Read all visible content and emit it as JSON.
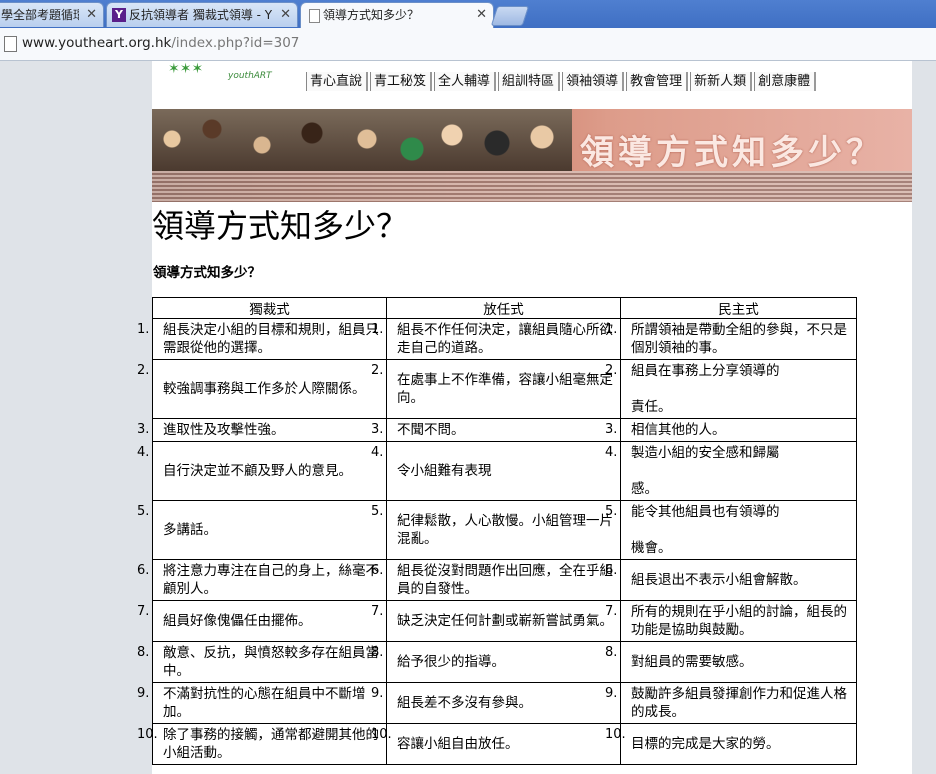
{
  "browser": {
    "tabs": [
      {
        "label": "學全部考題循環",
        "icon": "page-icon"
      },
      {
        "label": "反抗領導者 獨裁式領導 - Y",
        "icon": "yahoo-icon"
      },
      {
        "label": "領導方式知多少？",
        "icon": "page-icon"
      }
    ],
    "url_host": "www.youtheart.org.hk",
    "url_rest": "/index.php?id=307"
  },
  "site": {
    "logo_text": "youthART",
    "nav": [
      "青心直說",
      "青工秘笈",
      "全人輔導",
      "組訓特區",
      "領袖領導",
      "教會管理",
      "新新人類",
      "創意康體"
    ],
    "banner_title": "領導方式知多少？"
  },
  "article": {
    "title": "領導方式知多少？",
    "subtitle": "領導方式知多少？",
    "headers": [
      "獨裁式",
      "放任式",
      "民主式"
    ],
    "rows": [
      {
        "n": [
          "1.",
          "1.",
          "1."
        ],
        "cells": [
          "組長決定小組的目標和規則，組員只需跟從他的選擇。",
          "組長不作任何決定，讓組員隨心所欲走自己的道路。",
          "所謂領袖是帶動全組的參與，不只是個別領袖的事。"
        ]
      },
      {
        "n": [
          "2.",
          "2.",
          "2."
        ],
        "cells": [
          "較強調事務與工作多於人際關係。",
          "在處事上不作準備，容讓小組毫無定向。",
          "組員在事務上分享領導的\n\n責任。"
        ]
      },
      {
        "n": [
          "3.",
          "3.",
          "3."
        ],
        "cells": [
          "進取性及攻擊性強。",
          "不聞不問。",
          "相信其他的人。"
        ]
      },
      {
        "n": [
          "4.",
          "4.",
          "4."
        ],
        "cells": [
          "自行決定並不顧及野人的意見。",
          "令小組難有表現",
          "製造小組的安全感和歸屬\n\n感。"
        ]
      },
      {
        "n": [
          "5.",
          "5.",
          "5."
        ],
        "cells": [
          "多講話。",
          "紀律鬆散，人心散慢。小組管理一片混亂。",
          "能令其他組員也有領導的\n\n機會。"
        ]
      },
      {
        "n": [
          "6.",
          "6.",
          "6."
        ],
        "cells": [
          "將注意力專注在自己的身上，絲毫不顧別人。",
          "組長從沒對問題作出回應，全在乎組員的自發性。",
          "組長退出不表示小組會解散。"
        ]
      },
      {
        "n": [
          "7.",
          "7.",
          "7."
        ],
        "cells": [
          "組員好像傀儡任由擺佈。",
          "缺乏決定任何計劃或嶄新嘗試勇氣。",
          "所有的規則在乎小組的討論，組長的功能是協助與鼓勵。"
        ]
      },
      {
        "n": [
          "8.",
          "8.",
          "8."
        ],
        "cells": [
          "敵意、反抗，與憤怒較多存在組員當中。",
          "給予很少的指導。",
          "對組員的需要敏感。"
        ]
      },
      {
        "n": [
          "9.",
          "9.",
          "9."
        ],
        "cells": [
          "不滿對抗性的心態在組員中不斷增加。",
          "組長差不多沒有參與。",
          "鼓勵許多組員發揮創作力和促進人格的成長。"
        ]
      },
      {
        "n": [
          "10.",
          "10.",
          "10."
        ],
        "cells": [
          "除了事務的接觸，通常都避開其他的小組活動。",
          "容讓小組自由放任。",
          "目標的完成是大家的勞。"
        ]
      }
    ]
  }
}
